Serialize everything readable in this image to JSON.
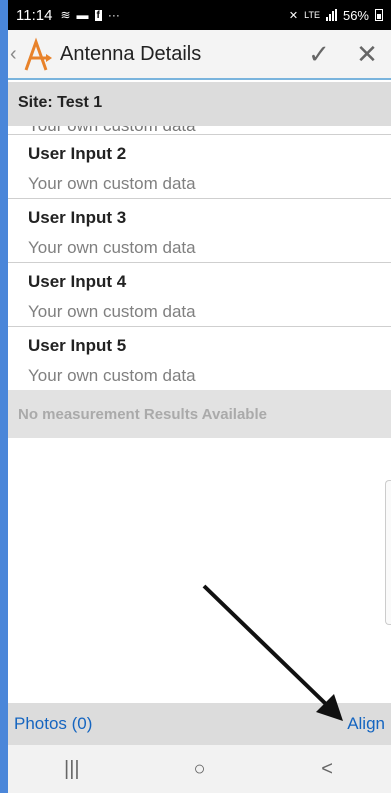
{
  "status_bar": {
    "time": "11:14",
    "notification_icons": [
      "wifi-call-icon",
      "message-icon",
      "facebook-icon",
      "more-icon"
    ],
    "network": "LTE",
    "battery": "56%"
  },
  "app_bar": {
    "back_glyph": "‹",
    "title": "Antenna Details",
    "confirm_glyph": "✓",
    "close_glyph": "✕"
  },
  "site_header": "Site: Test 1",
  "partial_item_value": "Your own custom data",
  "items": [
    {
      "label": "User Input 2",
      "value": "Your own custom data"
    },
    {
      "label": "User Input 3",
      "value": "Your own custom data"
    },
    {
      "label": "User Input 4",
      "value": "Your own custom data"
    },
    {
      "label": "User Input 5",
      "value": "Your own custom data"
    }
  ],
  "no_results": "No measurement Results Available",
  "footer": {
    "photos": "Photos (0)",
    "align": "Align"
  },
  "nav": {
    "recents": "|||",
    "home": "○",
    "back": "<"
  },
  "colors": {
    "link": "#1565c0",
    "logo_orange": "#e8822a",
    "appbar_underline": "#7ab4dd"
  }
}
